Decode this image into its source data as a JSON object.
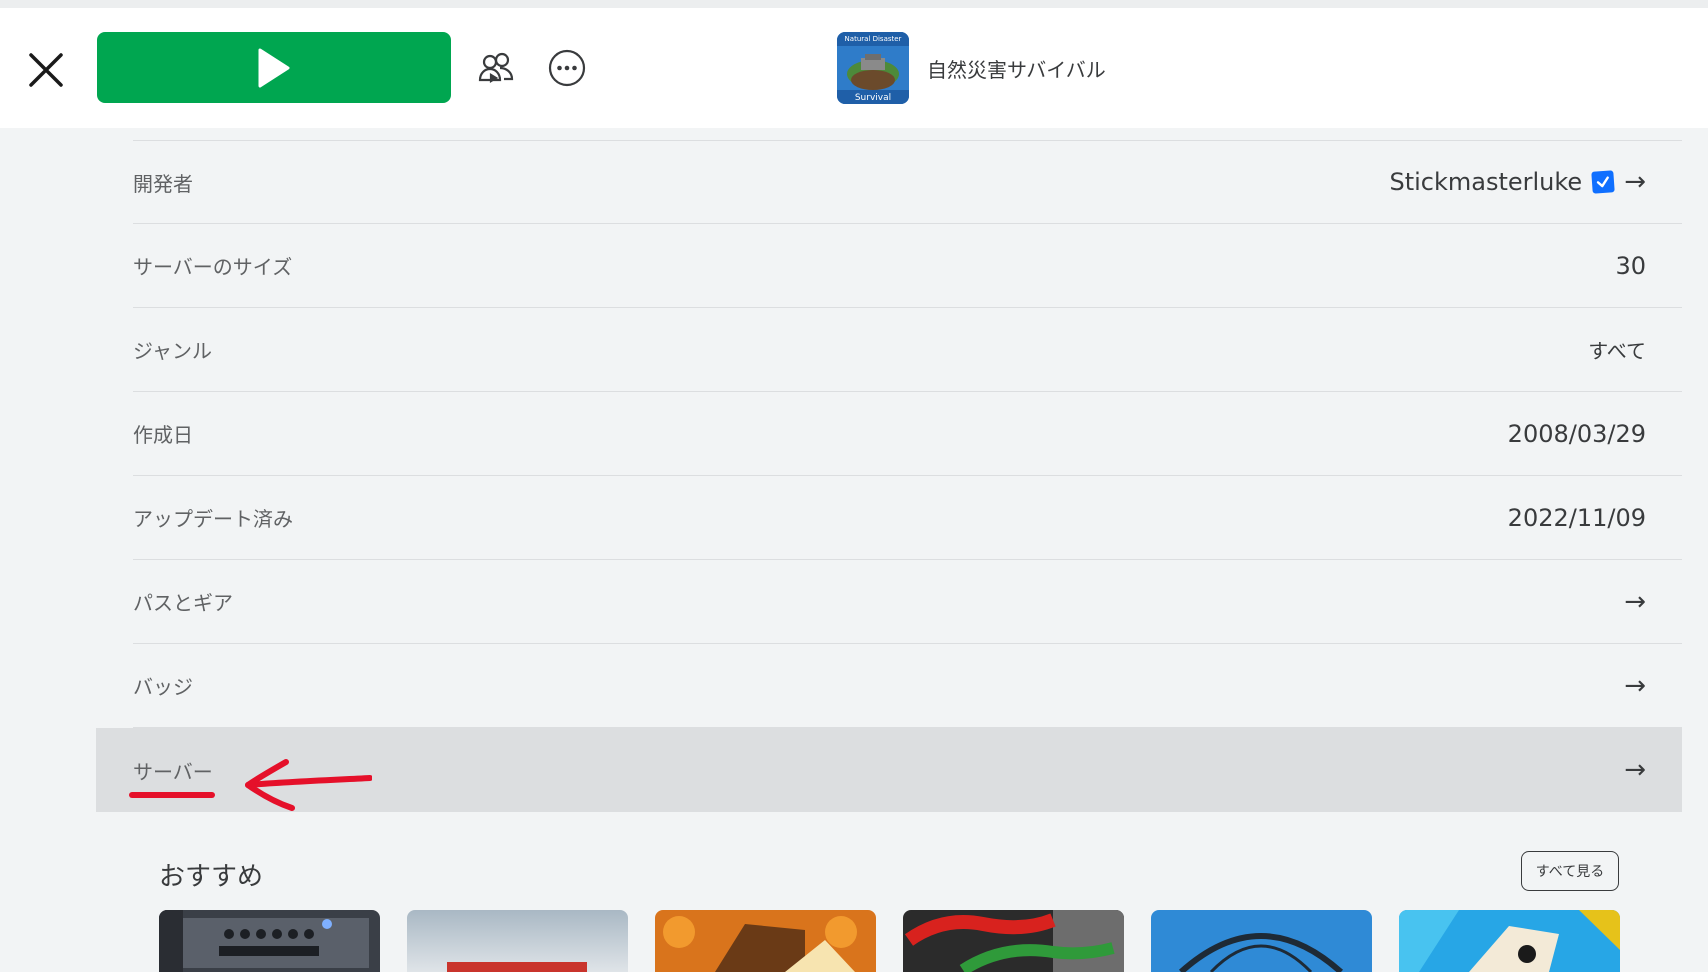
{
  "header": {
    "game_title": "自然災害サバイバル",
    "thumb_text_top": "Natural Disaster",
    "thumb_text_bottom": "Survival"
  },
  "details": [
    {
      "label": "開発者",
      "value": "Stickmasterluke",
      "has_arrow": true,
      "verified": true
    },
    {
      "label": "サーバーのサイズ",
      "value": "30",
      "has_arrow": false
    },
    {
      "label": "ジャンル",
      "value": "すべて",
      "has_arrow": false
    },
    {
      "label": "作成日",
      "value": "2008/03/29",
      "has_arrow": false
    },
    {
      "label": "アップデート済み",
      "value": "2022/11/09",
      "has_arrow": false
    },
    {
      "label": "パスとギア",
      "value": "",
      "has_arrow": true
    },
    {
      "label": "バッジ",
      "value": "",
      "has_arrow": true
    },
    {
      "label": "サーバー",
      "value": "",
      "has_arrow": true
    }
  ],
  "recommended": {
    "title": "おすすめ",
    "see_all_label": "すべて見る"
  },
  "colors": {
    "play_green": "#00a650",
    "annotation_red": "#e5102a",
    "highlight_row": "#dcdee0",
    "verified_blue": "#0f6fff"
  },
  "icons": [
    "close-icon",
    "play-icon",
    "party-icon",
    "more-icon",
    "arrow-right-icon",
    "verified-badge-icon"
  ]
}
